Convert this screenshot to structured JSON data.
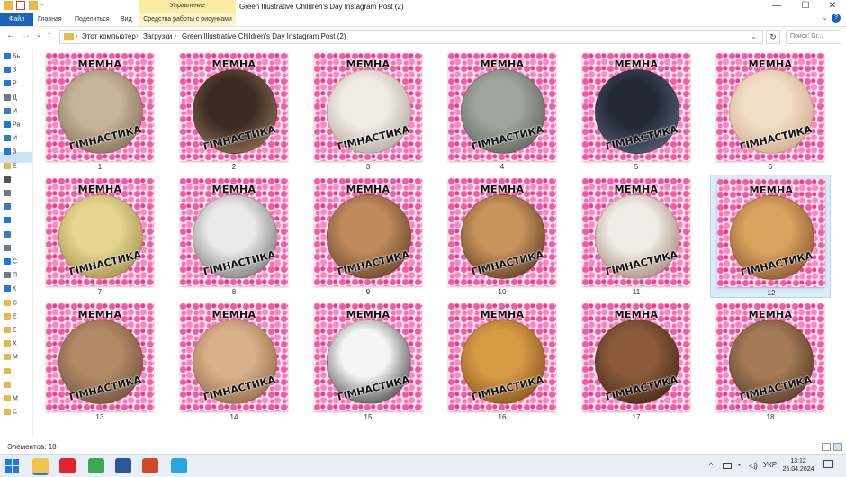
{
  "window": {
    "title": "Green Illustrative Children's Day Instagram Post (2)",
    "context_tab_group": "Управление",
    "controls": {
      "minimize": "—",
      "maximize": "☐",
      "close": "✕"
    }
  },
  "ribbon": {
    "tabs": [
      "Файл",
      "Главная",
      "Поделиться",
      "Вид",
      "Средства работы с рисунками"
    ],
    "collapse_glyph": "⌄",
    "help_glyph": "?"
  },
  "nav": {
    "back": "←",
    "forward": "→",
    "recent": "⌄",
    "up": "↑",
    "breadcrumb": [
      "Этот компьютер",
      "Загрузки",
      "Green Illustrative Children's Day Instagram Post (2)"
    ],
    "separator": "›",
    "dropdown_glyph": "⌄",
    "refresh_glyph": "↻",
    "search_placeholder": "Поиск: Gr..."
  },
  "sidebar": {
    "items": [
      {
        "label": "Бь",
        "icon": "star-icon",
        "color": "#1d7ad6"
      },
      {
        "label": "З",
        "icon": "download-icon",
        "color": "#1d7ad6"
      },
      {
        "label": "Р",
        "icon": "desktop-icon",
        "color": "#1d7ad6"
      },
      {
        "label": "Д",
        "icon": "document-icon",
        "color": "#6b7a8f"
      },
      {
        "label": "И",
        "icon": "picture-icon",
        "color": "#3a7bb8"
      },
      {
        "label": "Ра",
        "icon": "monitor-icon",
        "color": "#1d7ad6"
      },
      {
        "label": "И",
        "icon": "picture-icon",
        "color": "#3a7bb8"
      },
      {
        "label": "З",
        "icon": "desktop-icon",
        "color": "#1d7ad6"
      },
      {
        "label": "Е",
        "icon": "folder-icon",
        "color": "#e8b94a"
      },
      {
        "label": "",
        "icon": "phone-icon",
        "color": "#555555"
      },
      {
        "label": "",
        "icon": "document-icon",
        "color": "#6b7a8f"
      },
      {
        "label": "",
        "icon": "picture-icon",
        "color": "#3a7bb8"
      },
      {
        "label": "",
        "icon": "music-icon",
        "color": "#1d7ad6"
      },
      {
        "label": "",
        "icon": "picture-icon",
        "color": "#3a7bb8"
      },
      {
        "label": "",
        "icon": "video-icon",
        "color": "#6b7a8f"
      },
      {
        "label": "С",
        "icon": "cloud-icon",
        "color": "#1d7ad6"
      },
      {
        "label": "П",
        "icon": "drive-icon",
        "color": "#6b7a8f"
      },
      {
        "label": "К",
        "icon": "network-icon",
        "color": "#1d7ad6"
      },
      {
        "label": "С",
        "icon": "folder-icon",
        "color": "#e8b94a"
      },
      {
        "label": "Е",
        "icon": "folder-icon",
        "color": "#e8b94a"
      },
      {
        "label": "Е",
        "icon": "folder-icon",
        "color": "#e8b94a"
      },
      {
        "label": "Х",
        "icon": "folder-icon",
        "color": "#e8b94a"
      },
      {
        "label": "М",
        "icon": "folder-icon",
        "color": "#e8b94a"
      },
      {
        "label": "",
        "icon": "folder-icon",
        "color": "#e8b94a"
      },
      {
        "label": "",
        "icon": "folder-icon",
        "color": "#e8b94a"
      },
      {
        "label": "М",
        "icon": "folder-icon",
        "color": "#e8b94a"
      },
      {
        "label": "С",
        "icon": "folder-icon",
        "color": "#e8b94a"
      }
    ]
  },
  "files": [
    {
      "name": "1",
      "caption_top": "МЕМНА",
      "caption_bottom": "ГІМНАСТИКА",
      "photo": "cat-icon",
      "tones": [
        "#c8b49a",
        "#6f5a45"
      ],
      "selected": false
    },
    {
      "name": "2",
      "caption_top": "МЕМНА",
      "caption_bottom": "ГІМНАСТИКА",
      "photo": "cat-icon",
      "tones": [
        "#3b2a1f",
        "#a8866a"
      ],
      "selected": false
    },
    {
      "name": "3",
      "caption_top": "МЕМНА",
      "caption_bottom": "ГІМНАСТИКА",
      "photo": "cat-icon",
      "tones": [
        "#f1ece4",
        "#9e9288"
      ],
      "selected": false
    },
    {
      "name": "4",
      "caption_top": "МЕМНА",
      "caption_bottom": "ГІМНАСТИКА",
      "photo": "cat-icon",
      "tones": [
        "#9fa59a",
        "#4c524a"
      ],
      "selected": false
    },
    {
      "name": "5",
      "caption_top": "МЕМНА",
      "caption_bottom": "ГІМНАСТИКА",
      "photo": "cat-icon",
      "tones": [
        "#232937",
        "#65708a"
      ],
      "selected": false
    },
    {
      "name": "6",
      "caption_top": "МЕМНА",
      "caption_bottom": "ГІМНАСТИКА",
      "photo": "cat-icon",
      "tones": [
        "#f2ddc6",
        "#c49c7a"
      ],
      "selected": false
    },
    {
      "name": "7",
      "caption_top": "МЕМНА",
      "caption_bottom": "ГІМНАСТИКА",
      "photo": "cat-icon",
      "tones": [
        "#e7d68f",
        "#8c7a3e"
      ],
      "selected": false
    },
    {
      "name": "8",
      "caption_top": "МЕМНА",
      "caption_bottom": "ГІМНАСТИКА",
      "photo": "cat-icon",
      "tones": [
        "#e9e9e9",
        "#555555"
      ],
      "selected": false
    },
    {
      "name": "9",
      "caption_top": "МЕМНА",
      "caption_bottom": "ГІМНАСТИКА",
      "photo": "dog-icon",
      "tones": [
        "#c08a5c",
        "#4a2e1c"
      ],
      "selected": false
    },
    {
      "name": "10",
      "caption_top": "МЕМНА",
      "caption_bottom": "ГІМНАСТИКА",
      "photo": "dog-icon",
      "tones": [
        "#c9935c",
        "#3d2416"
      ],
      "selected": false
    },
    {
      "name": "11",
      "caption_top": "МЕМНА",
      "caption_bottom": "ГІМНАСТИКА",
      "photo": "dog-icon",
      "tones": [
        "#f1ede6",
        "#8a6a52"
      ],
      "selected": false
    },
    {
      "name": "12",
      "caption_top": "МЕМНА",
      "caption_bottom": "ГІМНАСТИКА",
      "photo": "dog-icon",
      "tones": [
        "#d9a25f",
        "#6b3f1c"
      ],
      "selected": true
    },
    {
      "name": "13",
      "caption_top": "МЕМНА",
      "caption_bottom": "ГІМНАСТИКА",
      "photo": "dog-icon",
      "tones": [
        "#b28a66",
        "#5a4330"
      ],
      "selected": false
    },
    {
      "name": "14",
      "caption_top": "МЕМНА",
      "caption_bottom": "ГІМНАСТИКА",
      "photo": "dog-icon",
      "tones": [
        "#d8b18a",
        "#7a5435"
      ],
      "selected": false
    },
    {
      "name": "15",
      "caption_top": "МЕМНА",
      "caption_bottom": "ГІМНАСТИКА",
      "photo": "dog-icon",
      "tones": [
        "#f5f5f5",
        "#111111"
      ],
      "selected": false
    },
    {
      "name": "16",
      "caption_top": "МЕМНА",
      "caption_bottom": "ГІМНАСТИКА",
      "photo": "dog-icon",
      "tones": [
        "#d79a45",
        "#6d3f12"
      ],
      "selected": false
    },
    {
      "name": "17",
      "caption_top": "МЕМНА",
      "caption_bottom": "ГІМНАСТИКА",
      "photo": "dog-icon",
      "tones": [
        "#8a5a3a",
        "#2e1a10"
      ],
      "selected": false
    },
    {
      "name": "18",
      "caption_top": "МЕМНА",
      "caption_bottom": "ГІМНАСТИКА",
      "photo": "dog-icon",
      "tones": [
        "#a37a55",
        "#3c2a1c"
      ],
      "selected": false
    }
  ],
  "status": {
    "item_count": "Элементов: 18"
  },
  "taskbar": {
    "apps": [
      {
        "icon": "file-explorer-icon",
        "color": "#f2c14e",
        "active": true
      },
      {
        "icon": "opera-icon",
        "color": "#e0262c",
        "active": false
      },
      {
        "icon": "chrome-icon",
        "color": "#3aa757",
        "active": false
      },
      {
        "icon": "word-icon",
        "color": "#2b579a",
        "active": false
      },
      {
        "icon": "powerpoint-icon",
        "color": "#d24726",
        "active": false
      },
      {
        "icon": "telegram-icon",
        "color": "#2aa3df",
        "active": false
      }
    ],
    "tray": {
      "chevron": "^",
      "language": "УКР",
      "time": "13:12",
      "date": "25.04.2024"
    }
  }
}
